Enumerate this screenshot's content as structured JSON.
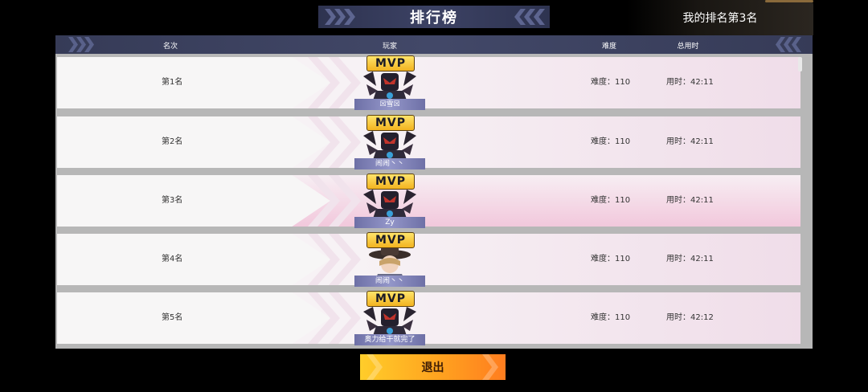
{
  "title": "排行榜",
  "my_rank": "我的排名第3名",
  "header": {
    "rank": "名次",
    "player": "玩家",
    "difficulty": "难度",
    "time": "总用时"
  },
  "rows": [
    {
      "rank": "第1名",
      "badge": "MVP",
      "player": "☒雪☒",
      "difficulty": "难度：110",
      "time": "用时：42:11",
      "avatar": "knight-avatar-icon",
      "highlight": false
    },
    {
      "rank": "第2名",
      "badge": "MVP",
      "player": "闹闹丶丶",
      "difficulty": "难度：110",
      "time": "用时：42:11",
      "avatar": "knight-avatar-icon",
      "highlight": false
    },
    {
      "rank": "第3名",
      "badge": "MVP",
      "player": "Zy",
      "difficulty": "难度：110",
      "time": "用时：42:11",
      "avatar": "knight-avatar-icon",
      "highlight": true
    },
    {
      "rank": "第4名",
      "badge": "MVP",
      "player": "闹闹丶丶",
      "difficulty": "难度：110",
      "time": "用时：42:11",
      "avatar": "hat-character-avatar-icon",
      "highlight": false
    },
    {
      "rank": "第5名",
      "badge": "MVP",
      "player": "奥力给干就完了",
      "difficulty": "难度：110",
      "time": "用时：42:12",
      "avatar": "knight-avatar-icon",
      "highlight": false
    }
  ],
  "exit_button": "退出",
  "colors": {
    "accent": "#ffa21f",
    "highlight_row": "#f2c8dc",
    "header_bg": "#3c4264"
  }
}
